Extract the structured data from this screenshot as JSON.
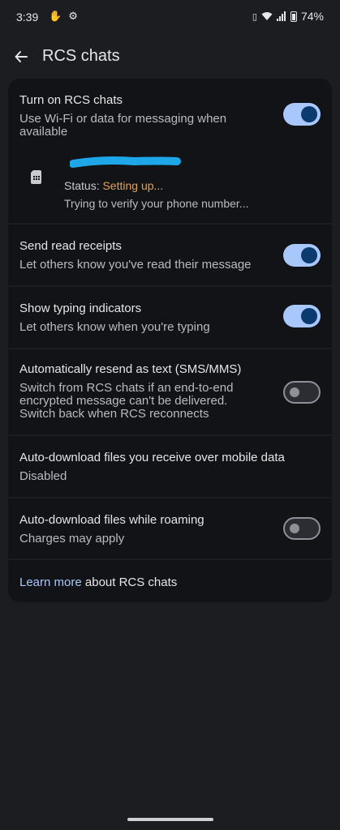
{
  "status_bar": {
    "time": "3:39",
    "battery": "74%",
    "icons": [
      "hand-icon",
      "gear-icon",
      "vibrate-icon",
      "wifi-icon",
      "signal-icon",
      "battery-icon"
    ]
  },
  "app_bar": {
    "title": "RCS chats",
    "back_icon": "arrow-back-icon"
  },
  "settings": {
    "rcs": {
      "title": "Turn on RCS chats",
      "subtitle_line1": "Use Wi-Fi or data for messaging when",
      "subtitle_line2": "available",
      "enabled": true
    },
    "sim": {
      "status_label": "Status: ",
      "status_value": "Setting up...",
      "detail": "Trying to verify your phone number..."
    },
    "read_receipts": {
      "title": "Send read receipts",
      "subtitle": "Let others know you've read their message",
      "enabled": true
    },
    "typing": {
      "title": "Show typing indicators",
      "subtitle": "Let others know when you're typing",
      "enabled": true
    },
    "resend": {
      "title": "Automatically resend as text (SMS/MMS)",
      "subtitle_line1": "Switch from RCS chats if an end-to-end",
      "subtitle_line2": "encrypted message can't be delivered.",
      "subtitle_line3": "Switch back when RCS reconnects",
      "enabled": false
    },
    "auto_download_mobile": {
      "title": "Auto-download files you receive over mobile data",
      "value": "Disabled"
    },
    "auto_download_roaming": {
      "title": "Auto-download files while roaming",
      "subtitle": "Charges may apply",
      "enabled": false
    },
    "learn_more": {
      "link": "Learn more",
      "rest": " about RCS chats"
    }
  },
  "colors": {
    "background": "#1b1d21",
    "card": "#121316",
    "toggle_on": "#a8c7fa",
    "status_warning": "#e0a15b",
    "link": "#a8c7fa"
  }
}
